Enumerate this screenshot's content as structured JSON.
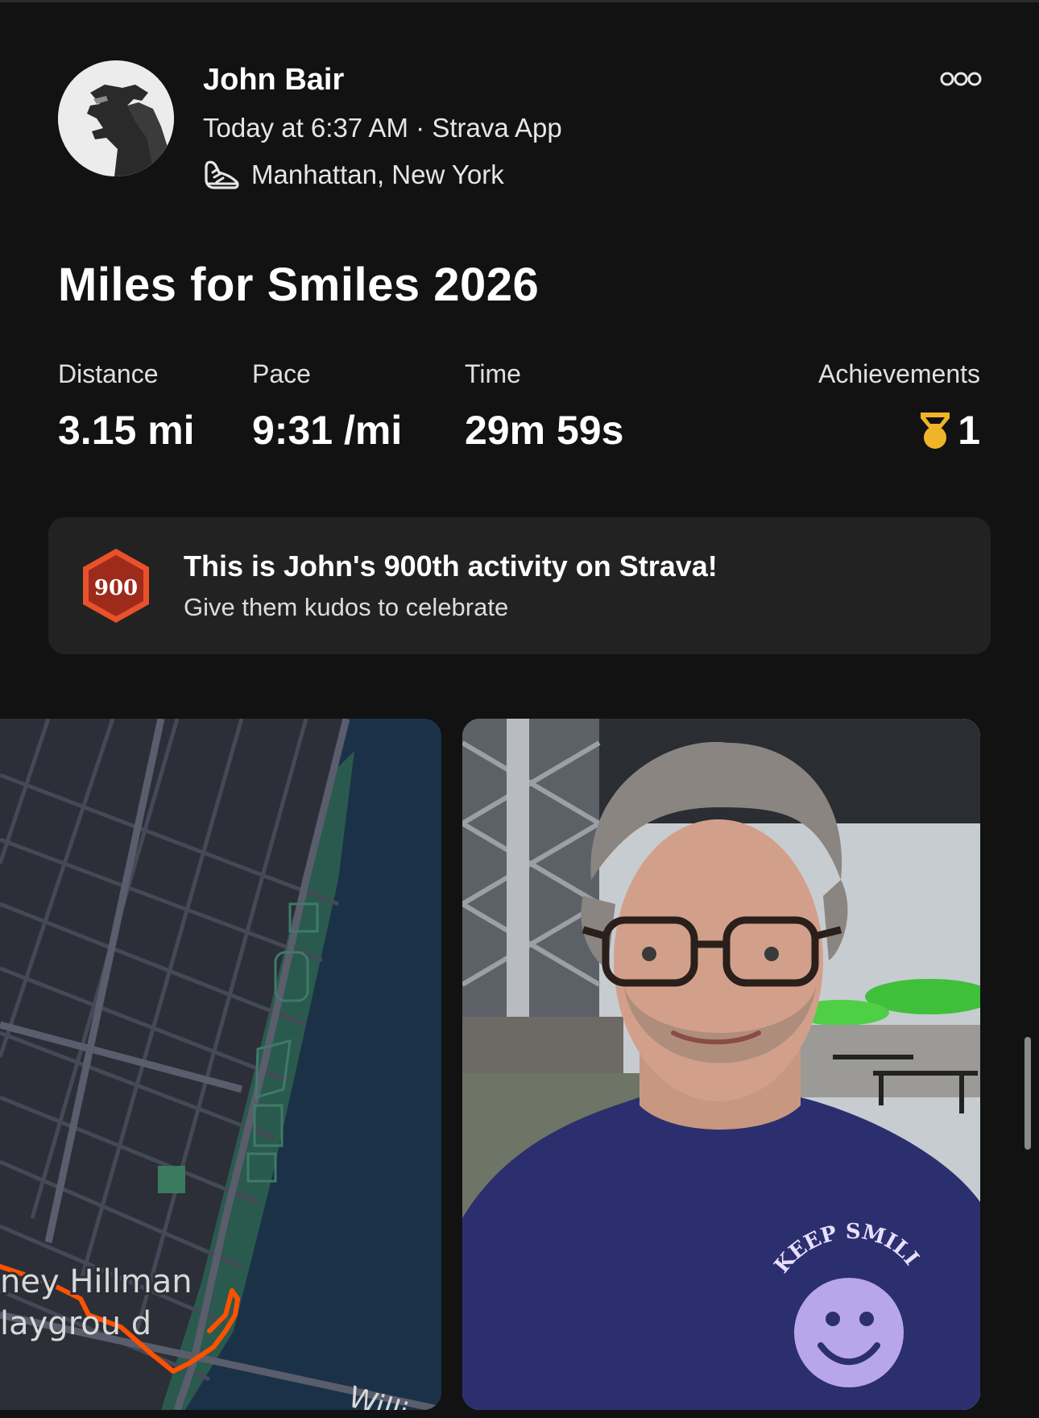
{
  "header": {
    "athlete_name": "John Bair",
    "meta": "Today at 6:37 AM · Strava App",
    "location": "Manhattan, New York",
    "sport_icon": "running-shoe-icon",
    "more_icon": "more-options-icon"
  },
  "activity": {
    "title": "Miles for Smiles 2026"
  },
  "stats": {
    "distance": {
      "label": "Distance",
      "value": "3.15 mi"
    },
    "pace": {
      "label": "Pace",
      "value": "9:31 /mi"
    },
    "time": {
      "label": "Time",
      "value": "29m 59s"
    },
    "achievements": {
      "label": "Achievements",
      "value": "1",
      "icon": "medal-icon",
      "icon_color": "#F0B429"
    }
  },
  "milestone": {
    "badge_number": "900",
    "badge_color": "#B0371B",
    "title": "This is John's 900th activity on Strava!",
    "subtitle": "Give them kudos to celebrate"
  },
  "map": {
    "labels": [
      "ney Hillman",
      "laygrou d",
      "Willi"
    ],
    "route_color": "#FC5200"
  },
  "photo": {
    "shirt_text": "KEEP SMILING"
  },
  "colors": {
    "background": "#121212",
    "card": "#222222",
    "accent": "#FC5200"
  }
}
